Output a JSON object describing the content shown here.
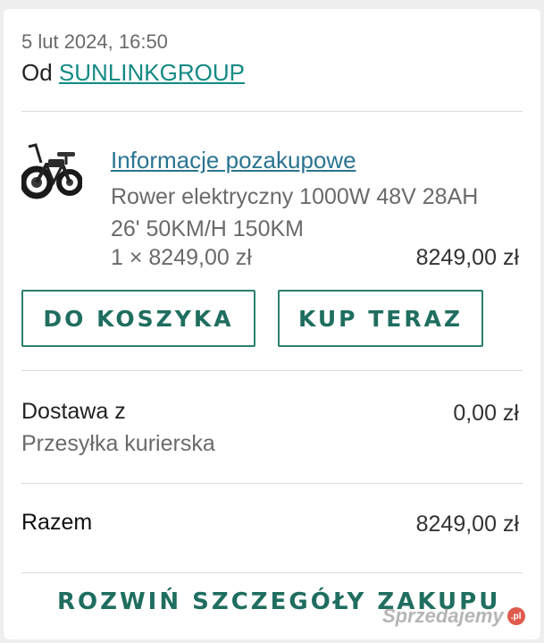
{
  "order": {
    "date": "5 lut 2024, 16:50",
    "from_prefix": "Od",
    "seller": "SUNLINKGROUP"
  },
  "item": {
    "info_link": "Informacje pozakupowe",
    "title": "Rower elektryczny 1000W 48V 28AH 26' 50KM/H 150KM",
    "quantity_price": "1 × 8249,00 zł",
    "line_total": "8249,00 zł",
    "thumbnail_icon": "electric-bike-icon"
  },
  "actions": {
    "add_to_cart": "DO KOSZYKA",
    "buy_now": "KUP TERAZ"
  },
  "shipping": {
    "label": "Dostawa z",
    "method": "Przesyłka kurierska",
    "price": "0,00 zł"
  },
  "total": {
    "label": "Razem",
    "price": "8249,00 zł"
  },
  "footer": {
    "expand_details": "ROZWIŃ SZCZEGÓŁY ZAKUPU"
  },
  "watermark": {
    "text": "Sprzedajemy",
    "badge": ".pl"
  },
  "colors": {
    "accent_green": "#1f6e60",
    "link_teal": "#138a84",
    "link_blue": "#2a7491"
  }
}
